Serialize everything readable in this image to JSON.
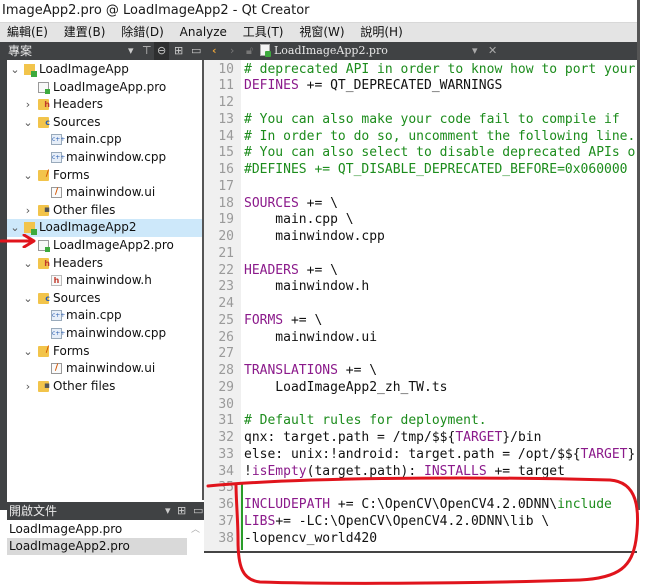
{
  "window": {
    "title": "ImageApp2.pro @ LoadImageApp2 - Qt Creator"
  },
  "menubar": {
    "items": [
      {
        "label": "編輯(E)"
      },
      {
        "label": "建置(B)"
      },
      {
        "label": "除錯(D)"
      },
      {
        "label": "Analyze"
      },
      {
        "label": "工具(T)"
      },
      {
        "label": "視窗(W)"
      },
      {
        "label": "說明(H)"
      }
    ]
  },
  "project_panel": {
    "title": "專案",
    "icons": [
      "dropdown-icon",
      "filter-icon",
      "link-icon",
      "split-icon",
      "close-panel-icon"
    ],
    "tree": [
      {
        "label": "LoadImageApp",
        "type": "project",
        "depth": 0,
        "expanded": true
      },
      {
        "label": "LoadImageApp.pro",
        "type": "pro",
        "depth": 1
      },
      {
        "label": "Headers",
        "type": "folder-headers",
        "depth": 1,
        "expanded": false
      },
      {
        "label": "Sources",
        "type": "folder-sources",
        "depth": 1,
        "expanded": true
      },
      {
        "label": "main.cpp",
        "type": "cpp",
        "depth": 2
      },
      {
        "label": "mainwindow.cpp",
        "type": "cpp",
        "depth": 2
      },
      {
        "label": "Forms",
        "type": "folder-forms",
        "depth": 1,
        "expanded": true
      },
      {
        "label": "mainwindow.ui",
        "type": "ui",
        "depth": 2
      },
      {
        "label": "Other files",
        "type": "folder-other",
        "depth": 1,
        "expanded": false
      },
      {
        "label": "LoadImageApp2",
        "type": "project",
        "depth": 0,
        "expanded": true,
        "selected": true
      },
      {
        "label": "LoadImageApp2.pro",
        "type": "pro",
        "depth": 1
      },
      {
        "label": "Headers",
        "type": "folder-headers",
        "depth": 1,
        "expanded": true
      },
      {
        "label": "mainwindow.h",
        "type": "h",
        "depth": 2
      },
      {
        "label": "Sources",
        "type": "folder-sources",
        "depth": 1,
        "expanded": true
      },
      {
        "label": "main.cpp",
        "type": "cpp",
        "depth": 2
      },
      {
        "label": "mainwindow.cpp",
        "type": "cpp",
        "depth": 2
      },
      {
        "label": "Forms",
        "type": "folder-forms",
        "depth": 1,
        "expanded": true
      },
      {
        "label": "mainwindow.ui",
        "type": "ui",
        "depth": 2
      },
      {
        "label": "Other files",
        "type": "folder-other",
        "depth": 1,
        "expanded": false
      }
    ]
  },
  "open_documents": {
    "title": "開啟文件",
    "items": [
      {
        "label": "LoadImageApp.pro",
        "selected": false
      },
      {
        "label": "LoadImageApp2.pro",
        "selected": true
      }
    ]
  },
  "editor": {
    "current_file": "LoadImageApp2.pro",
    "lines": [
      {
        "num": "10",
        "tokens": [
          {
            "t": "# deprecated API in order to know how to port your",
            "c": "comment"
          }
        ]
      },
      {
        "num": "11",
        "tokens": [
          {
            "t": "DEFINES",
            "c": "kw"
          },
          {
            "t": " += QT_DEPRECATED_WARNINGS",
            "c": "plain"
          }
        ]
      },
      {
        "num": "12",
        "tokens": []
      },
      {
        "num": "13",
        "tokens": [
          {
            "t": "# You can also make your code fail to compile if ",
            "c": "comment"
          }
        ]
      },
      {
        "num": "14",
        "tokens": [
          {
            "t": "# In order to do so, uncomment the following line.",
            "c": "comment"
          }
        ]
      },
      {
        "num": "15",
        "tokens": [
          {
            "t": "# You can also select to disable deprecated APIs o",
            "c": "comment"
          }
        ]
      },
      {
        "num": "16",
        "tokens": [
          {
            "t": "#DEFINES += QT_DISABLE_DEPRECATED_BEFORE=0x060000",
            "c": "comment"
          }
        ]
      },
      {
        "num": "17",
        "tokens": []
      },
      {
        "num": "18",
        "tokens": [
          {
            "t": "SOURCES",
            "c": "kw"
          },
          {
            "t": " += \\",
            "c": "plain"
          }
        ]
      },
      {
        "num": "19",
        "tokens": [
          {
            "t": "    main.cpp \\",
            "c": "plain"
          }
        ]
      },
      {
        "num": "20",
        "tokens": [
          {
            "t": "    mainwindow.cpp",
            "c": "plain"
          }
        ]
      },
      {
        "num": "21",
        "tokens": []
      },
      {
        "num": "22",
        "tokens": [
          {
            "t": "HEADERS",
            "c": "kw"
          },
          {
            "t": " += \\",
            "c": "plain"
          }
        ]
      },
      {
        "num": "23",
        "tokens": [
          {
            "t": "    mainwindow.h",
            "c": "plain"
          }
        ]
      },
      {
        "num": "24",
        "tokens": []
      },
      {
        "num": "25",
        "tokens": [
          {
            "t": "FORMS",
            "c": "kw"
          },
          {
            "t": " += \\",
            "c": "plain"
          }
        ]
      },
      {
        "num": "26",
        "tokens": [
          {
            "t": "    mainwindow.ui",
            "c": "plain"
          }
        ]
      },
      {
        "num": "27",
        "tokens": []
      },
      {
        "num": "28",
        "tokens": [
          {
            "t": "TRANSLATIONS",
            "c": "kw"
          },
          {
            "t": " += \\",
            "c": "plain"
          }
        ]
      },
      {
        "num": "29",
        "tokens": [
          {
            "t": "    LoadImageApp2_zh_TW.ts",
            "c": "plain"
          }
        ]
      },
      {
        "num": "30",
        "tokens": []
      },
      {
        "num": "31",
        "tokens": [
          {
            "t": "# Default rules for deployment.",
            "c": "comment"
          }
        ]
      },
      {
        "num": "32",
        "tokens": [
          {
            "t": "qnx: target.path = /tmp/$${",
            "c": "plain"
          },
          {
            "t": "TARGET",
            "c": "var"
          },
          {
            "t": "}/bin",
            "c": "plain"
          }
        ]
      },
      {
        "num": "33",
        "tokens": [
          {
            "t": "else: unix:!android: target.path = /opt/$${",
            "c": "plain"
          },
          {
            "t": "TARGET",
            "c": "var"
          },
          {
            "t": "}",
            "c": "plain"
          }
        ]
      },
      {
        "num": "34",
        "tokens": [
          {
            "t": "!",
            "c": "plain"
          },
          {
            "t": "isEmpty",
            "c": "var"
          },
          {
            "t": "(target.path): ",
            "c": "plain"
          },
          {
            "t": "INSTALLS",
            "c": "kw"
          },
          {
            "t": " += target",
            "c": "plain"
          }
        ]
      },
      {
        "num": "35",
        "tokens": []
      },
      {
        "num": "36",
        "tokens": [
          {
            "t": "INCLUDEPATH",
            "c": "kw"
          },
          {
            "t": " += C:\\OpenCV\\OpenCV4.2.0DNN\\",
            "c": "plain"
          },
          {
            "t": "include",
            "c": "comment"
          }
        ]
      },
      {
        "num": "37",
        "tokens": [
          {
            "t": "LIBS",
            "c": "kw"
          },
          {
            "t": "+= -LC:\\OpenCV\\OpenCV4.2.0DNN\\lib \\",
            "c": "plain"
          }
        ]
      },
      {
        "num": "38",
        "tokens": [
          {
            "t": "-lopencv_world420",
            "c": "plain"
          }
        ]
      }
    ]
  },
  "colors": {
    "comment": "#1c8c1c",
    "keyword": "#8b1a8b",
    "toolbar_bg": "#404244",
    "selection": "#cde8fa",
    "annotation_red": "#e0141c"
  }
}
